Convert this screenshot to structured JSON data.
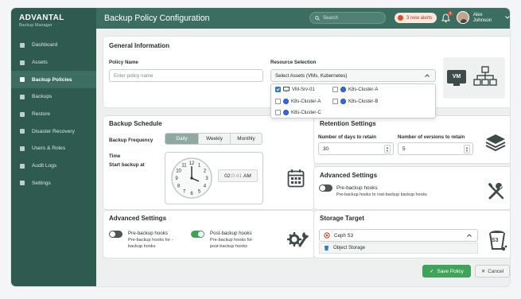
{
  "brand": {
    "name": "ADVANTAL",
    "sub": "Backup Manager"
  },
  "sidebar": {
    "items": [
      {
        "label": "Dashboard"
      },
      {
        "label": "Assets"
      },
      {
        "label": "Backup Policies"
      },
      {
        "label": "Backups"
      },
      {
        "label": "Restore"
      },
      {
        "label": "Disaster Recovery"
      },
      {
        "label": "Users & Roles"
      },
      {
        "label": "Audit Logs"
      },
      {
        "label": "Settings"
      }
    ],
    "active_index": 2
  },
  "header": {
    "title": "Backup Policy Configuration",
    "search_placeholder": "Search",
    "alerts": "3 new alerts",
    "bell_count": "3",
    "user": "Alex Johnson"
  },
  "general": {
    "title": "General Information",
    "policy_label": "Policy Name",
    "policy_placeholder": "Enter policy name",
    "resource_label": "Resource Selection",
    "resource_value": "Select Assets (VMs, Kubernetes)",
    "assets": [
      {
        "label": "VM-Srv-01",
        "checked": true,
        "kind": "vm"
      },
      {
        "label": "K8s-Cluster-A",
        "checked": false,
        "kind": "k8s"
      },
      {
        "label": "K8s-Cluster-A",
        "checked": false,
        "kind": "k8s"
      },
      {
        "label": "K8s-Cluster-B",
        "checked": false,
        "kind": "k8s"
      },
      {
        "label": "K8s-Cluster-C",
        "checked": false,
        "kind": "k8s"
      }
    ],
    "vm_badge": "VM"
  },
  "schedule": {
    "title": "Backup Schedule",
    "frequency_label": "Backup Frequency",
    "options": [
      "Daily",
      "Weekly",
      "Monthly"
    ],
    "selected": "Daily",
    "time_label": "Time",
    "start_label": "Start backup at",
    "time_h": "02:",
    "time_m": "0:41",
    "ampm": "AM",
    "clock_numbers": [
      "12",
      "1",
      "2",
      "3",
      "4",
      "5",
      "6",
      "7",
      "8",
      "9",
      "10",
      "11"
    ]
  },
  "retention": {
    "title": "Retention Settings",
    "days_label": "Number of days to retain",
    "days_value": "30",
    "versions_label": "Number of versions to retain",
    "versions_value": "5"
  },
  "advanced_right": {
    "title": "Advanced Settings",
    "toggle_label": "Pre-backup hooks",
    "toggle_desc": "Pre-backup hooks to rost-backup backup hooks",
    "toggle_on": false
  },
  "advanced_left": {
    "title": "Advanced Settings",
    "pre_label": "Pre-backup hooks",
    "pre_desc1": "Pre-backup hooks for -",
    "pre_desc2": "backup hooks",
    "pre_on": false,
    "post_label": "Post-backup hooks",
    "post_desc1": "Pre-backup hooks for",
    "post_desc2": "post-backup hooks",
    "post_on": true
  },
  "storage": {
    "title": "Storage Target",
    "selected": "Ceph S3",
    "option": "Object Storage",
    "icon_text": "S3"
  },
  "actions": {
    "save": "Save Policy",
    "cancel": "Cancel"
  },
  "colors": {
    "sidebar": "#2f5a50",
    "header": "#3b6e61",
    "accent_green": "#3fa45a",
    "alert": "#d4502c"
  }
}
